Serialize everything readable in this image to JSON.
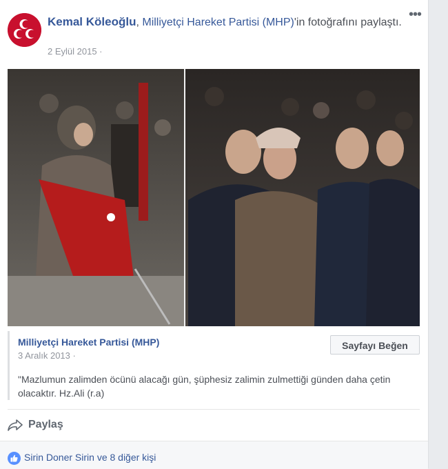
{
  "post": {
    "author": "Kemal Köleoğlu",
    "sep": ", ",
    "page": "Milliyetçi Hareket Partisi (MHP)",
    "shared_text": "'in fotoğrafını paylaştı.",
    "date": "2 Eylül 2015 ·"
  },
  "shared": {
    "page_name": "Milliyetçi Hareket Partisi (MHP)",
    "date": "3 Aralık 2013 ·",
    "like_page_button": "Sayfayı Beğen",
    "quote": "\"Mazlumun zalimden öcünü alacağı gün, şüphesiz zalimin zulmettiği günden daha çetin olacaktır. Hz.Ali (r.a)"
  },
  "actions": {
    "share": "Paylaş"
  },
  "reactions": {
    "text": "Sirin Doner Sirin ve 8 diğer kişi"
  },
  "colors": {
    "link": "#365899",
    "accent_red": "#c8102e",
    "like_blue": "#5890ff"
  }
}
